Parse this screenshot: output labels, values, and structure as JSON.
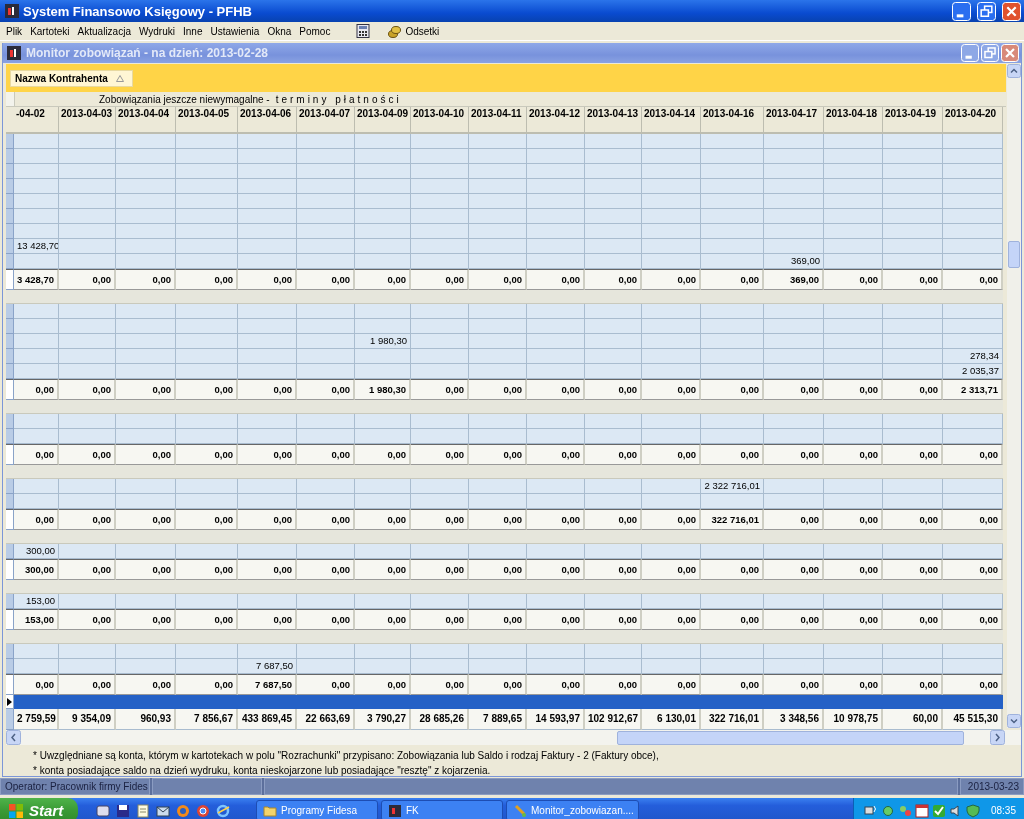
{
  "window": {
    "title": "System Finansowo Księgowy - PFHB"
  },
  "menu": [
    "Plik",
    "Kartoteki",
    "Aktualizacja",
    "Wydruki",
    "Inne",
    "Ustawienia",
    "Okna",
    "Pomoc"
  ],
  "toolbar": {
    "odsetki": "Odsetki"
  },
  "child_window": {
    "title": "Monitor zobowiązań - na dzień: 2013-02-28"
  },
  "group_panel": {
    "field": "Nazwa Kontrahenta"
  },
  "band": {
    "title": "Zobowiązania jeszcze niewymagalne -",
    "subtitle": "terminy płatności"
  },
  "table": {
    "columns": [
      "-04-02",
      "2013-04-03",
      "2013-04-04",
      "2013-04-05",
      "2013-04-06",
      "2013-04-07",
      "2013-04-09",
      "2013-04-10",
      "2013-04-11",
      "2013-04-12",
      "2013-04-13",
      "2013-04-14",
      "2013-04-16",
      "2013-04-17",
      "2013-04-18",
      "2013-04-19",
      "2013-04-20"
    ],
    "groups": [
      {
        "rows": [
          [
            null,
            null,
            null,
            null,
            null,
            null,
            null,
            null,
            null,
            null,
            null,
            null,
            null,
            null,
            null,
            null,
            null
          ],
          [
            null,
            null,
            null,
            null,
            null,
            null,
            null,
            null,
            null,
            null,
            null,
            null,
            null,
            null,
            null,
            null,
            null
          ],
          [
            null,
            null,
            null,
            null,
            null,
            null,
            null,
            null,
            null,
            null,
            null,
            null,
            null,
            null,
            null,
            null,
            null
          ],
          [
            null,
            null,
            null,
            null,
            null,
            null,
            null,
            null,
            null,
            null,
            null,
            null,
            null,
            null,
            null,
            null,
            null
          ],
          [
            null,
            null,
            null,
            null,
            null,
            null,
            null,
            null,
            null,
            null,
            null,
            null,
            null,
            null,
            null,
            null,
            null
          ],
          [
            null,
            null,
            null,
            null,
            null,
            null,
            null,
            null,
            null,
            null,
            null,
            null,
            null,
            null,
            null,
            null,
            null
          ],
          [
            null,
            null,
            null,
            null,
            null,
            null,
            null,
            null,
            null,
            null,
            null,
            null,
            null,
            null,
            null,
            null,
            null
          ],
          [
            "13 428,70",
            null,
            null,
            null,
            null,
            null,
            null,
            null,
            null,
            null,
            null,
            null,
            null,
            null,
            null,
            null,
            null
          ],
          [
            null,
            null,
            null,
            null,
            null,
            null,
            null,
            null,
            null,
            null,
            null,
            null,
            null,
            "369,00",
            null,
            null,
            null
          ]
        ],
        "total": [
          "3 428,70",
          "0,00",
          "0,00",
          "0,00",
          "0,00",
          "0,00",
          "0,00",
          "0,00",
          "0,00",
          "0,00",
          "0,00",
          "0,00",
          "0,00",
          "369,00",
          "0,00",
          "0,00",
          "0,00"
        ]
      },
      {
        "rows": [
          [
            null,
            null,
            null,
            null,
            null,
            null,
            null,
            null,
            null,
            null,
            null,
            null,
            null,
            null,
            null,
            null,
            null
          ],
          [
            null,
            null,
            null,
            null,
            null,
            null,
            null,
            null,
            null,
            null,
            null,
            null,
            null,
            null,
            null,
            null,
            null
          ],
          [
            null,
            null,
            null,
            null,
            null,
            null,
            "1 980,30",
            null,
            null,
            null,
            null,
            null,
            null,
            null,
            null,
            null,
            null
          ],
          [
            null,
            null,
            null,
            null,
            null,
            null,
            null,
            null,
            null,
            null,
            null,
            null,
            null,
            null,
            null,
            null,
            "278,34"
          ],
          [
            null,
            null,
            null,
            null,
            null,
            null,
            null,
            null,
            null,
            null,
            null,
            null,
            null,
            null,
            null,
            null,
            "2 035,37"
          ]
        ],
        "total": [
          "0,00",
          "0,00",
          "0,00",
          "0,00",
          "0,00",
          "0,00",
          "1 980,30",
          "0,00",
          "0,00",
          "0,00",
          "0,00",
          "0,00",
          "0,00",
          "0,00",
          "0,00",
          "0,00",
          "2 313,71"
        ]
      },
      {
        "rows": [
          [
            null,
            null,
            null,
            null,
            null,
            null,
            null,
            null,
            null,
            null,
            null,
            null,
            null,
            null,
            null,
            null,
            null
          ],
          [
            null,
            null,
            null,
            null,
            null,
            null,
            null,
            null,
            null,
            null,
            null,
            null,
            null,
            null,
            null,
            null,
            null
          ]
        ],
        "total": [
          "0,00",
          "0,00",
          "0,00",
          "0,00",
          "0,00",
          "0,00",
          "0,00",
          "0,00",
          "0,00",
          "0,00",
          "0,00",
          "0,00",
          "0,00",
          "0,00",
          "0,00",
          "0,00",
          "0,00"
        ]
      },
      {
        "rows": [
          [
            null,
            null,
            null,
            null,
            null,
            null,
            null,
            null,
            null,
            null,
            null,
            null,
            "2 322 716,01",
            null,
            null,
            null,
            null
          ],
          [
            null,
            null,
            null,
            null,
            null,
            null,
            null,
            null,
            null,
            null,
            null,
            null,
            null,
            null,
            null,
            null,
            null
          ]
        ],
        "total": [
          "0,00",
          "0,00",
          "0,00",
          "0,00",
          "0,00",
          "0,00",
          "0,00",
          "0,00",
          "0,00",
          "0,00",
          "0,00",
          "0,00",
          "322 716,01",
          "0,00",
          "0,00",
          "0,00",
          "0,00"
        ]
      },
      {
        "rows": [
          [
            "300,00",
            null,
            null,
            null,
            null,
            null,
            null,
            null,
            null,
            null,
            null,
            null,
            null,
            null,
            null,
            null,
            null
          ]
        ],
        "total": [
          "300,00",
          "0,00",
          "0,00",
          "0,00",
          "0,00",
          "0,00",
          "0,00",
          "0,00",
          "0,00",
          "0,00",
          "0,00",
          "0,00",
          "0,00",
          "0,00",
          "0,00",
          "0,00",
          "0,00"
        ]
      },
      {
        "rows": [
          [
            "153,00",
            null,
            null,
            null,
            null,
            null,
            null,
            null,
            null,
            null,
            null,
            null,
            null,
            null,
            null,
            null,
            null
          ]
        ],
        "total": [
          "153,00",
          "0,00",
          "0,00",
          "0,00",
          "0,00",
          "0,00",
          "0,00",
          "0,00",
          "0,00",
          "0,00",
          "0,00",
          "0,00",
          "0,00",
          "0,00",
          "0,00",
          "0,00",
          "0,00"
        ]
      },
      {
        "rows": [
          [
            null,
            null,
            null,
            null,
            null,
            null,
            null,
            null,
            null,
            null,
            null,
            null,
            null,
            null,
            null,
            null,
            null
          ],
          [
            null,
            null,
            null,
            null,
            "7 687,50",
            null,
            null,
            null,
            null,
            null,
            null,
            null,
            null,
            null,
            null,
            null,
            null
          ]
        ],
        "total": [
          "0,00",
          "0,00",
          "0,00",
          "0,00",
          "7 687,50",
          "0,00",
          "0,00",
          "0,00",
          "0,00",
          "0,00",
          "0,00",
          "0,00",
          "0,00",
          "0,00",
          "0,00",
          "0,00",
          "0,00"
        ]
      }
    ],
    "focus_row": {
      "selected": true
    },
    "grand_total": [
      "2 759,59",
      "9 354,09",
      "960,93",
      "7 856,67",
      "433 869,45",
      "22 663,69",
      "3 790,27",
      "28 685,26",
      "7 889,65",
      "14 593,97",
      "102 912,67",
      "6 130,01",
      "322 716,01",
      "3 348,56",
      "10 978,75",
      "60,00",
      "45 515,30"
    ]
  },
  "footnotes": [
    "* Uwzględniane są konta, którym w kartotekach w polu \"Rozrachunki\" przypisano: Zobowiązania lub Saldo i rodzaj Faktury - 2 (Faktury obce),",
    "* konta posiadające  saldo na dzień wydruku,  konta nieskojarzone lub posiadające \"resztę\" z kojarzenia."
  ],
  "status_bar": {
    "operator": "Operator: Pracownik firmy Fides",
    "date": "2013-03-23"
  },
  "taskbar": {
    "start": "Start",
    "tasks": [
      "Programy Fidesa",
      "FK",
      "Monitor_zobowiazan...."
    ],
    "clock": "08:35"
  }
}
